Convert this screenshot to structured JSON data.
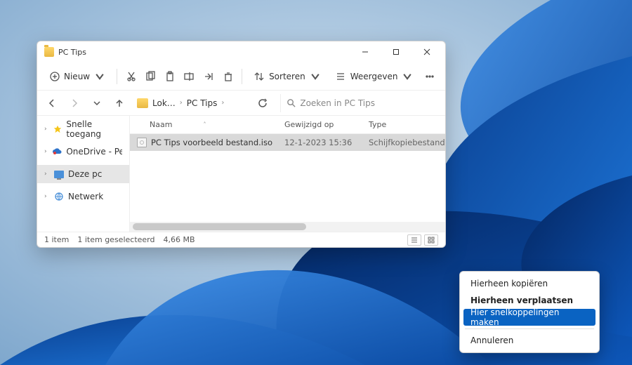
{
  "window": {
    "title": "PC Tips",
    "toolbar": {
      "new_label": "Nieuw",
      "sort_label": "Sorteren",
      "view_label": "Weergeven"
    },
    "breadcrumbs": {
      "seg1": "Lok…",
      "seg2": "PC Tips"
    },
    "search_placeholder": "Zoeken in PC Tips",
    "sidebar": {
      "items": [
        {
          "label": "Snelle toegang"
        },
        {
          "label": "OneDrive - Personal"
        },
        {
          "label": "Deze pc"
        },
        {
          "label": "Netwerk"
        }
      ]
    },
    "columns": {
      "name": "Naam",
      "modified": "Gewijzigd op",
      "type": "Type"
    },
    "files": [
      {
        "name": "PC Tips voorbeeld bestand.iso",
        "modified": "12-1-2023 15:36",
        "type": "Schijfkopiebestand"
      }
    ],
    "status": {
      "count": "1 item",
      "selection": "1 item geselecteerd",
      "size": "4,66 MB"
    }
  },
  "context_menu": {
    "copy": "Hierheen kopiëren",
    "move": "Hierheen verplaatsen",
    "shortcut": "Hier snelkoppelingen maken",
    "cancel": "Annuleren"
  }
}
